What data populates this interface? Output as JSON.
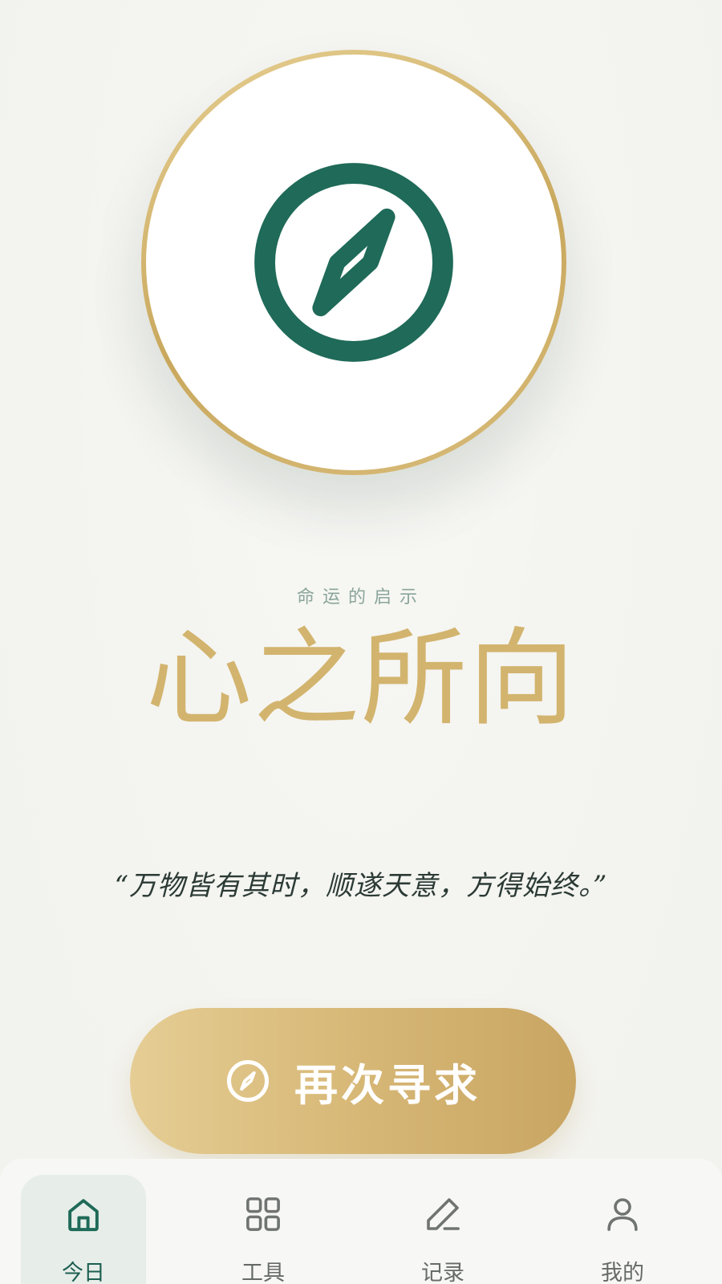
{
  "hero": {
    "icon": "compass-icon"
  },
  "subtitle": "命运的启示",
  "title": "心之所向",
  "quote": "“万物皆有其时，顺遂天意，方得始终。”",
  "cta": {
    "label": "再次寻求",
    "icon": "compass-icon"
  },
  "tabs": [
    {
      "label": "今日",
      "icon": "home-icon",
      "active": true
    },
    {
      "label": "工具",
      "icon": "grid-icon",
      "active": false
    },
    {
      "label": "记录",
      "icon": "pen-icon",
      "active": false
    },
    {
      "label": "我的",
      "icon": "user-icon",
      "active": false
    }
  ],
  "colors": {
    "primary_green": "#1f6a58",
    "gold": "#d2b46e",
    "background": "#f4f4f0"
  }
}
